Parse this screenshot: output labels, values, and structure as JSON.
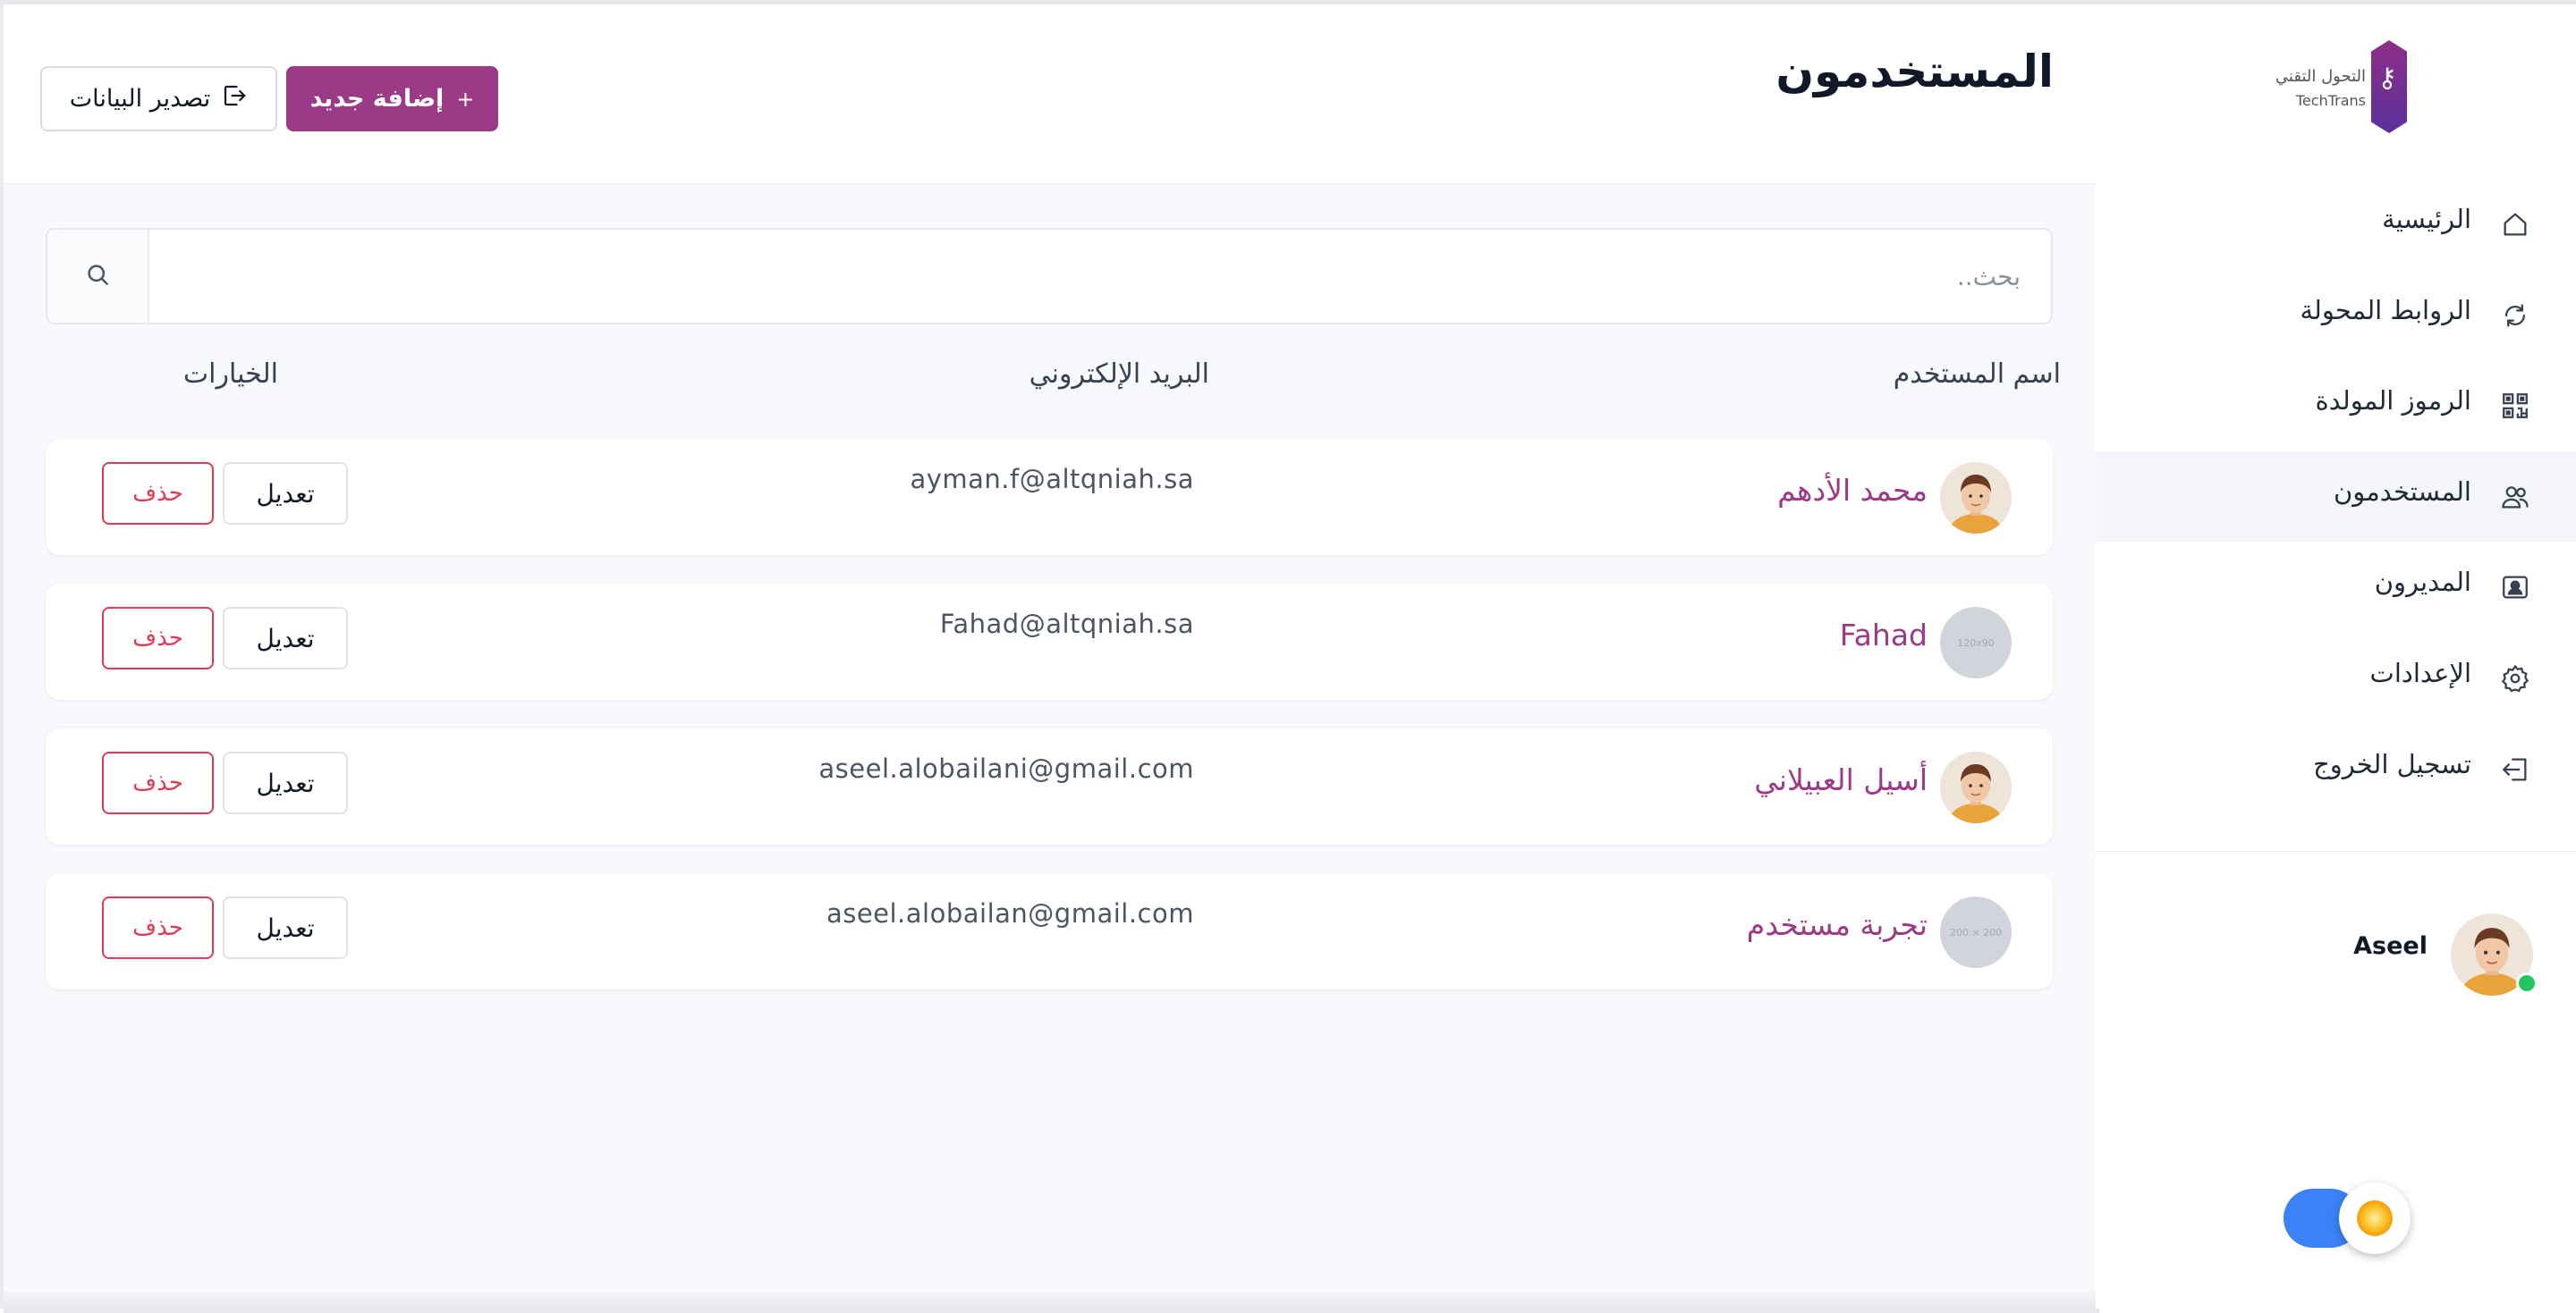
{
  "brand": {
    "logo_text_ar": "التحول التقني",
    "logo_text_en": "TechTrans"
  },
  "sidebar": {
    "items": [
      {
        "label": "الرئيسية",
        "icon": "home-icon",
        "active": false
      },
      {
        "label": "الروابط المحولة",
        "icon": "refresh-icon",
        "active": false
      },
      {
        "label": "الرموز المولدة",
        "icon": "qr-code-icon",
        "active": false
      },
      {
        "label": "المستخدمون",
        "icon": "users-icon",
        "active": true
      },
      {
        "label": "المديرون",
        "icon": "admin-badge-icon",
        "active": false
      },
      {
        "label": "الإعدادات",
        "icon": "gear-icon",
        "active": false
      },
      {
        "label": "تسجيل الخروج",
        "icon": "logout-icon",
        "active": false
      }
    ],
    "profile": {
      "name": "Aseel",
      "status": "online"
    }
  },
  "header": {
    "title": "المستخدمون",
    "add_button": "إضافة جديد",
    "export_button": "تصدير البيانات"
  },
  "search": {
    "placeholder": "بحث..",
    "value": ""
  },
  "table": {
    "columns": [
      "اسم المستخدم",
      "البريد الإلكتروني",
      "الخيارات"
    ],
    "rows": [
      {
        "name": "محمد الأدهم",
        "email": "ayman.f@altqniah.sa",
        "avatar": "face",
        "edit": "تعديل",
        "delete": "حذف"
      },
      {
        "name": "Fahad",
        "email": "Fahad@altqniah.sa",
        "avatar": "placeholder",
        "avatar_text": "120x90",
        "edit": "تعديل",
        "delete": "حذف"
      },
      {
        "name": "أسيل العبيلاني",
        "email": "aseel.alobailani@gmail.com",
        "avatar": "face",
        "edit": "تعديل",
        "delete": "حذف"
      },
      {
        "name": "تجربة مستخدم",
        "email": "aseel.alobailan@gmail.com",
        "avatar": "placeholder",
        "avatar_text": "200 × 200",
        "edit": "تعديل",
        "delete": "حذف"
      }
    ]
  },
  "theme": {
    "mode": "light",
    "toggle_on": true
  },
  "colors": {
    "accent": "#9b3a86",
    "danger": "#e03a55",
    "toggle": "#3b82f6"
  }
}
